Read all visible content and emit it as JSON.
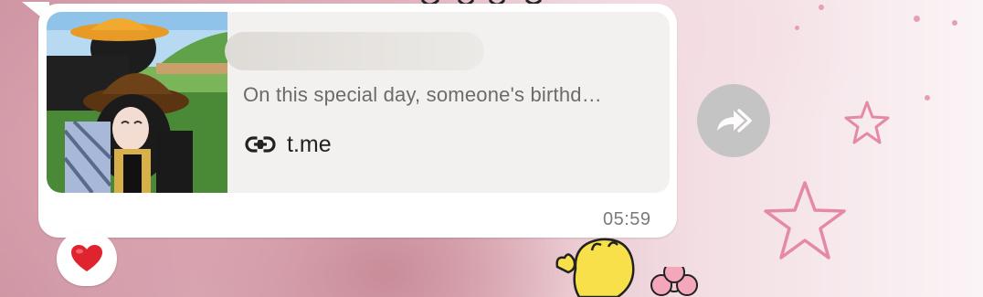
{
  "message": {
    "link_preview": {
      "thumbnail_icon": "avatar-thumbnail",
      "title_blurred": true,
      "description": "On this special day, someone's birthd…",
      "link_icon": "link-icon",
      "domain": "t.me"
    },
    "time": "05:59",
    "reaction": {
      "emoji": "❤️",
      "icon": "heart-icon"
    },
    "share_icon": "share-forward-icon"
  },
  "wallpaper": {
    "theme": "pink doodle",
    "accent_color": "#e7a0b2"
  },
  "colors": {
    "bubble": "#ffffff",
    "preview_bg": "#f3f1ef",
    "description_text": "#6b6b6b",
    "domain_text": "#222222",
    "time_text": "#7a7a7a",
    "share_button": "#c2c2c2",
    "heart": "#e0242f"
  }
}
